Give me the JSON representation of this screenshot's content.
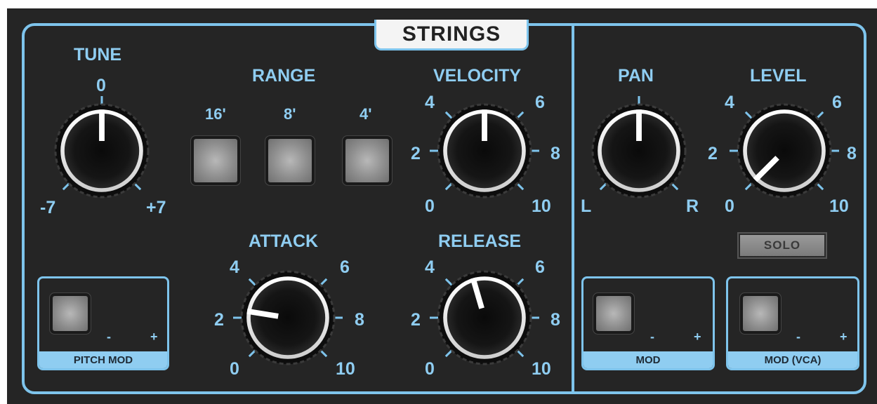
{
  "title": "STRINGS",
  "tune": {
    "label": "TUNE",
    "center": "0",
    "min": "-7",
    "max": "+7"
  },
  "range": {
    "label": "RANGE",
    "buttons": [
      "16'",
      "8'",
      "4'"
    ]
  },
  "velocity": {
    "label": "VELOCITY",
    "ticks": [
      "0",
      "2",
      "4",
      "6",
      "8",
      "10"
    ]
  },
  "attack": {
    "label": "ATTACK",
    "ticks": [
      "0",
      "2",
      "4",
      "6",
      "8",
      "10"
    ]
  },
  "release": {
    "label": "RELEASE",
    "ticks": [
      "0",
      "2",
      "4",
      "6",
      "8",
      "10"
    ]
  },
  "pan": {
    "label": "PAN",
    "left": "L",
    "right": "R"
  },
  "level": {
    "label": "LEVEL",
    "ticks": [
      "0",
      "2",
      "4",
      "6",
      "8",
      "10"
    ]
  },
  "solo": {
    "label": "SOLO"
  },
  "mods": {
    "pitch": {
      "label": "PITCH MOD",
      "minus": "-",
      "plus": "+"
    },
    "mod": {
      "label": "MOD",
      "minus": "-",
      "plus": "+"
    },
    "vca": {
      "label": "MOD (VCA)",
      "minus": "-",
      "plus": "+"
    }
  },
  "colors": {
    "accent": "#7ec4ec",
    "label": "#8fcdf1",
    "panel": "#252525"
  },
  "knob_values": {
    "tune": 0.5,
    "velocity": 0.5,
    "attack": 0.2,
    "release": 0.44,
    "pan": 0.5,
    "level": 0.0
  }
}
